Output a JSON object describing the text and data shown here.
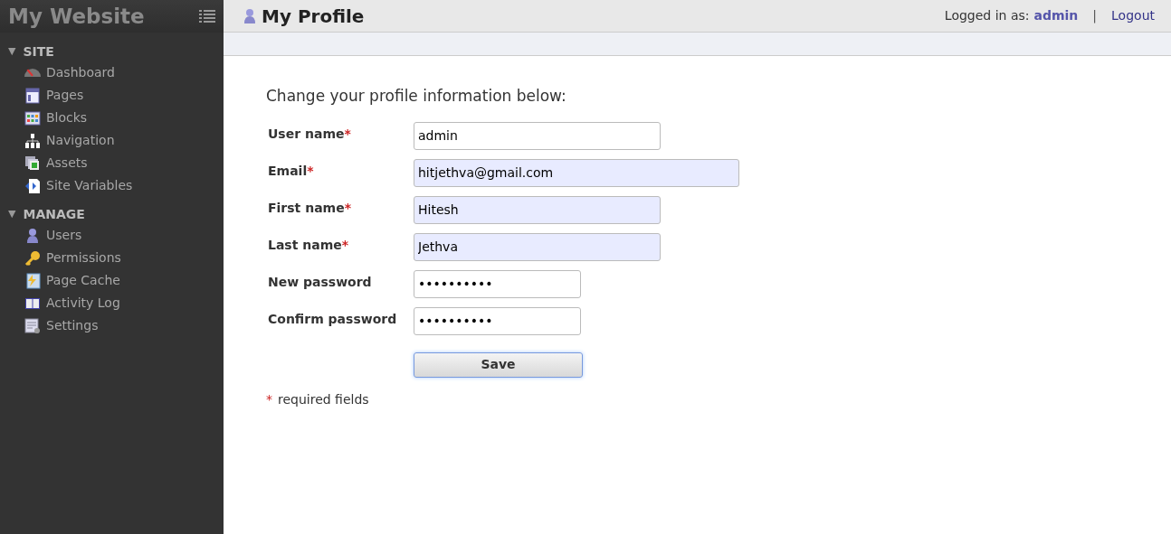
{
  "sidebar": {
    "title": "My Website",
    "sections": [
      {
        "label": "SITE",
        "toggle": "▼",
        "expanded": true,
        "items": [
          {
            "label": "Dashboard"
          },
          {
            "label": "Pages"
          },
          {
            "label": "Blocks"
          },
          {
            "label": "Navigation"
          },
          {
            "label": "Assets"
          },
          {
            "label": "Site Variables"
          }
        ]
      },
      {
        "label": "MANAGE",
        "toggle": "▼",
        "expanded": true,
        "items": [
          {
            "label": "Users"
          },
          {
            "label": "Permissions"
          },
          {
            "label": "Page Cache"
          },
          {
            "label": "Activity Log"
          },
          {
            "label": "Settings"
          }
        ]
      }
    ]
  },
  "header": {
    "title": "My Profile",
    "logged_in_label": "Logged in as:",
    "user": "admin",
    "separator": "|",
    "logout": "Logout"
  },
  "form": {
    "intro": "Change your profile information below:",
    "required_mark": "*",
    "fields": [
      {
        "label": "User name",
        "value": "admin",
        "required": true,
        "autofilled": false
      },
      {
        "label": "Email",
        "value": "hitjethva@gmail.com",
        "required": true,
        "autofilled": true
      },
      {
        "label": "First name",
        "value": "Hitesh",
        "required": true,
        "autofilled": true
      },
      {
        "label": "Last name",
        "value": "Jethva",
        "required": true,
        "autofilled": true
      },
      {
        "label": "New password",
        "value": "••••••••••",
        "required": false,
        "autofilled": false
      },
      {
        "label": "Confirm password",
        "value": "••••••••••",
        "required": false,
        "autofilled": false
      }
    ],
    "save": "Save",
    "footnote": "required fields"
  }
}
